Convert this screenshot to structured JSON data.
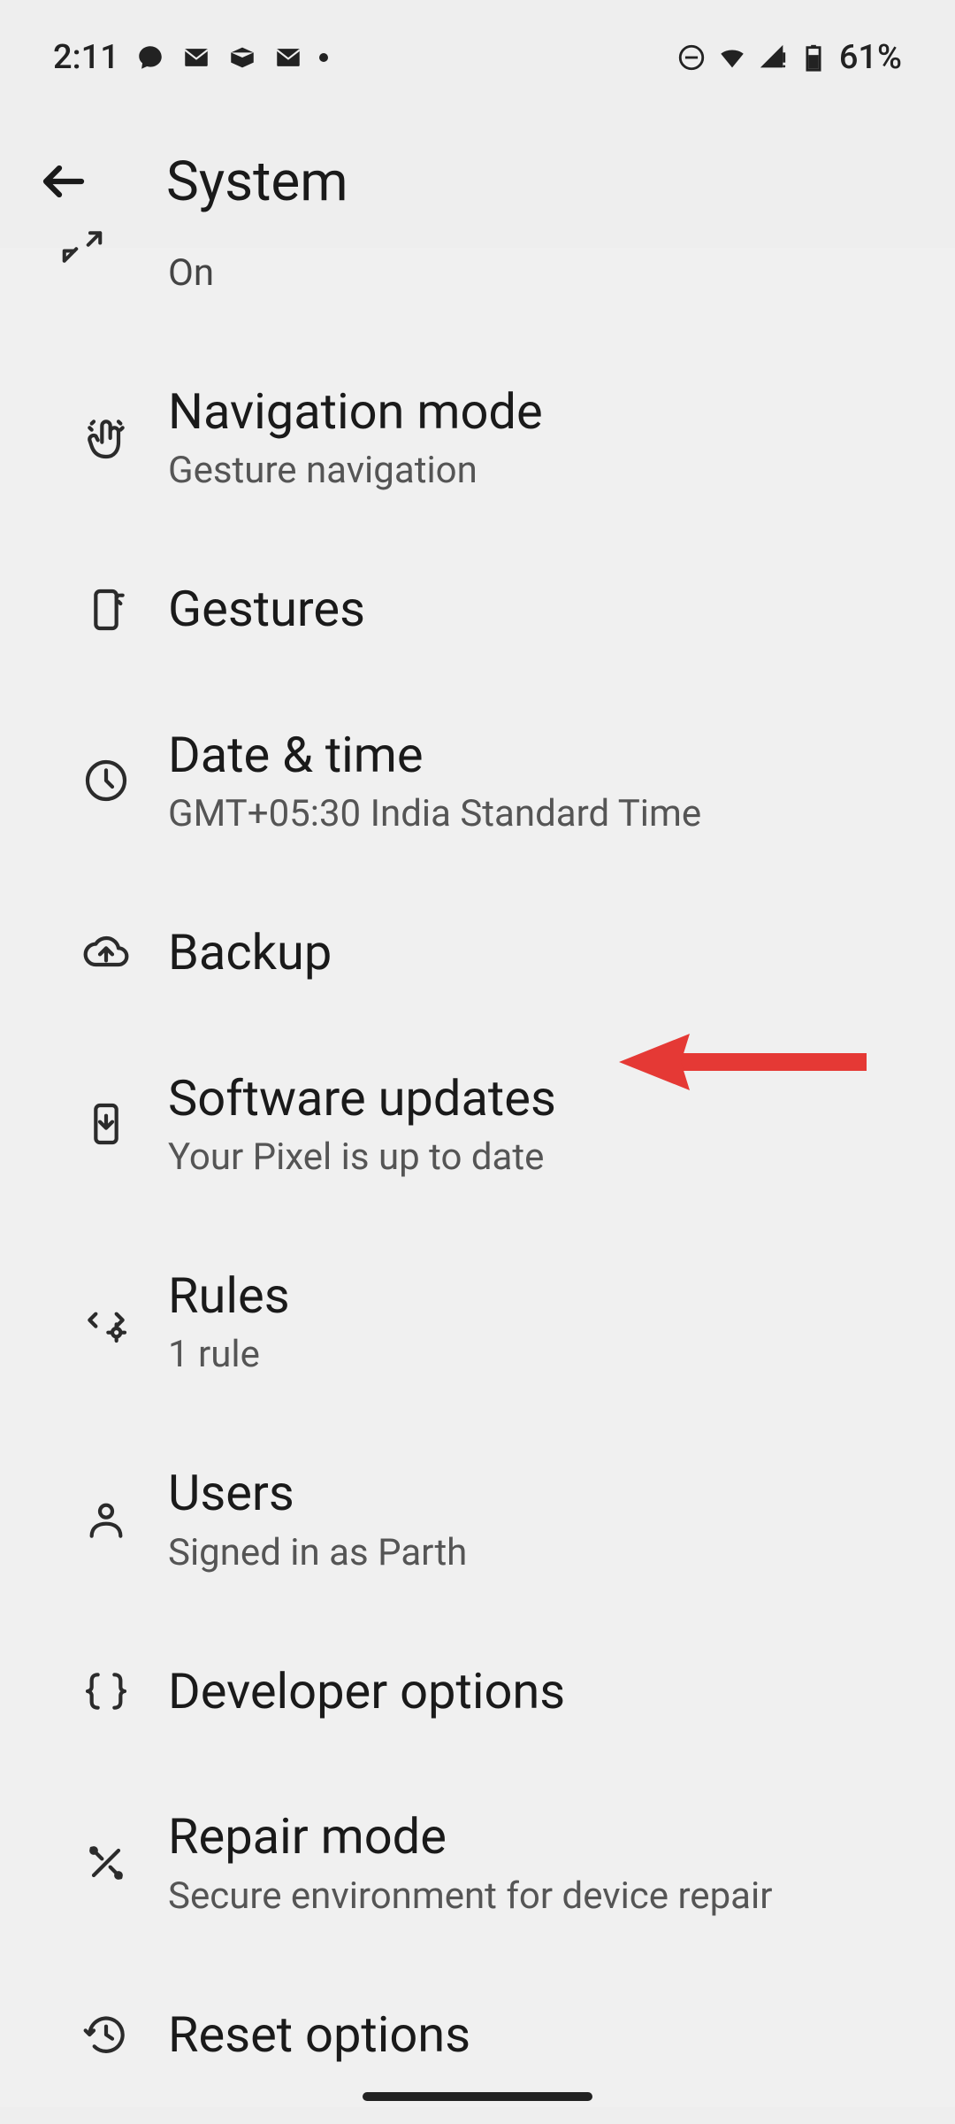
{
  "status": {
    "time": "2:11",
    "battery": "61%"
  },
  "header": {
    "title": "System"
  },
  "partial": {
    "subtitle": "On"
  },
  "items": [
    {
      "label": "Navigation mode",
      "subtitle": "Gesture navigation",
      "icon": "hand-swipe"
    },
    {
      "label": "Gestures",
      "subtitle": "",
      "icon": "phone-sparkle"
    },
    {
      "label": "Date & time",
      "subtitle": "GMT+05:30 India Standard Time",
      "icon": "clock"
    },
    {
      "label": "Backup",
      "subtitle": "",
      "icon": "cloud-up"
    },
    {
      "label": "Software updates",
      "subtitle": "Your Pixel is up to date",
      "icon": "phone-down"
    },
    {
      "label": "Rules",
      "subtitle": "1 rule",
      "icon": "arrows-gear"
    },
    {
      "label": "Users",
      "subtitle": "Signed in as Parth",
      "icon": "person"
    },
    {
      "label": "Developer options",
      "subtitle": "",
      "icon": "braces"
    },
    {
      "label": "Repair mode",
      "subtitle": "Secure environment for device repair",
      "icon": "tools"
    },
    {
      "label": "Reset options",
      "subtitle": "",
      "icon": "history"
    }
  ],
  "annotation": {
    "points_to_index": 4,
    "color": "#e53935"
  }
}
